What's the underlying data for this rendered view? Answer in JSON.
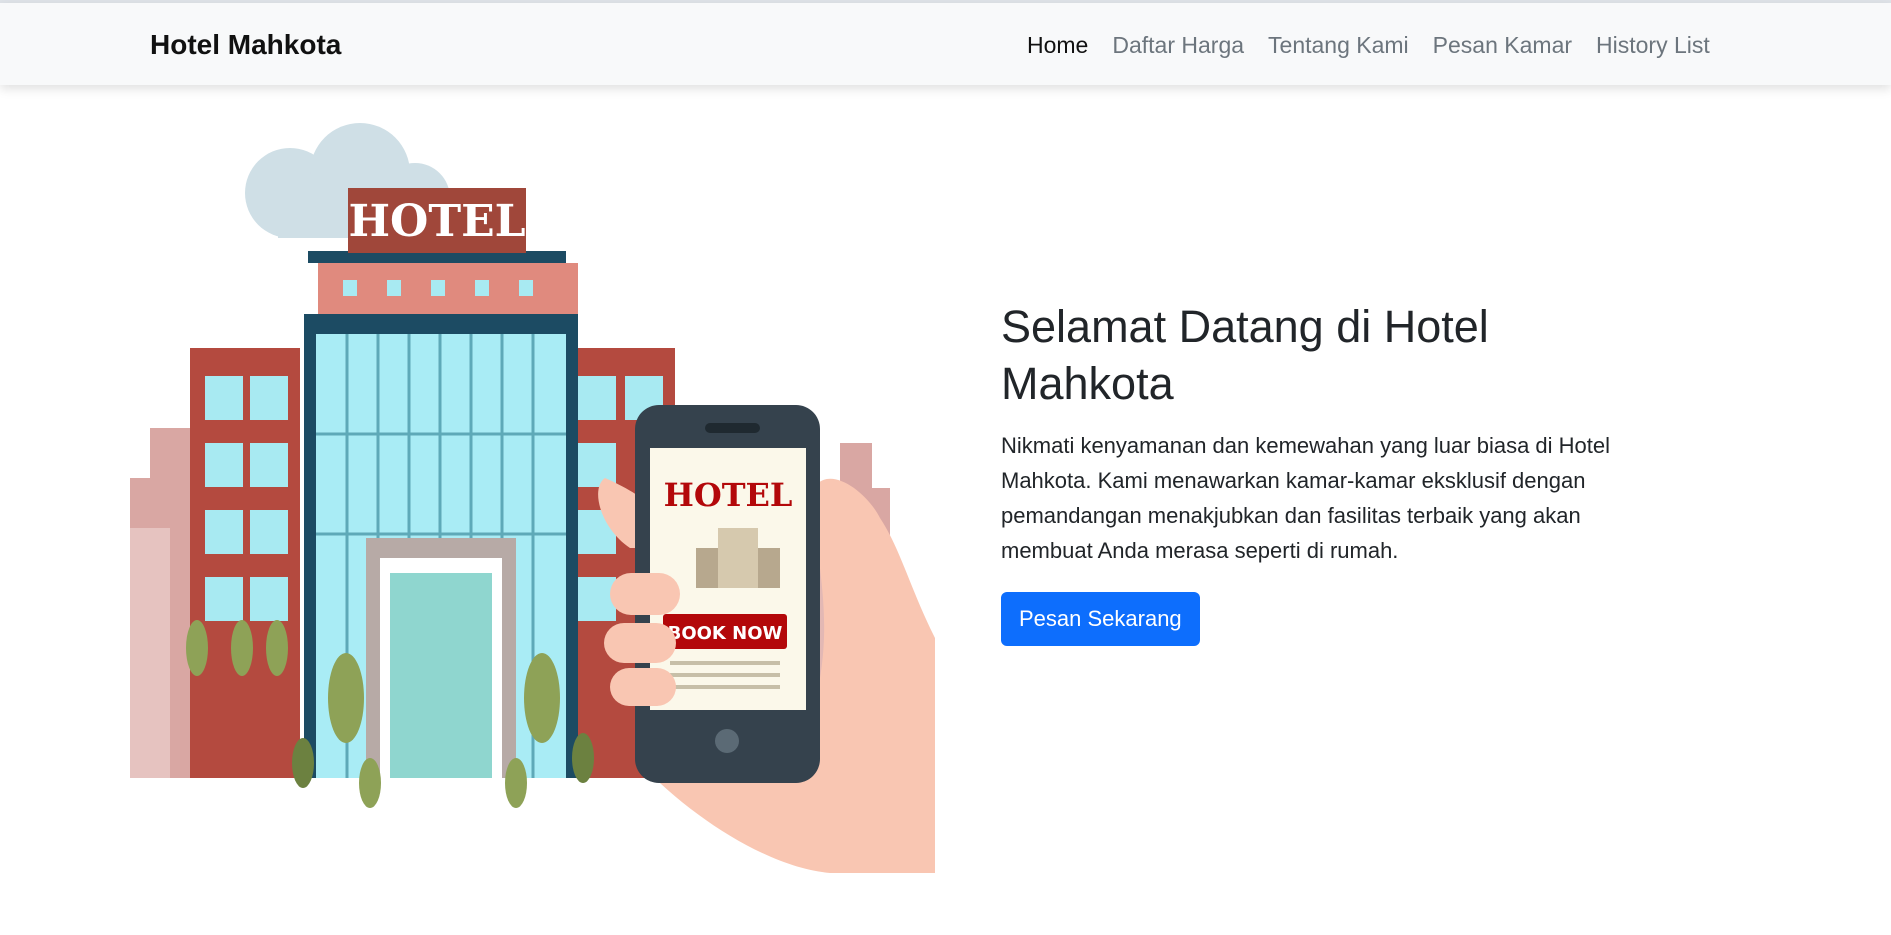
{
  "navbar": {
    "brand": "Hotel Mahkota",
    "items": [
      {
        "label": "Home",
        "active": true
      },
      {
        "label": "Daftar Harga",
        "active": false
      },
      {
        "label": "Tentang Kami",
        "active": false
      },
      {
        "label": "Pesan Kamar",
        "active": false
      },
      {
        "label": "History List",
        "active": false
      }
    ]
  },
  "hero": {
    "title": "Selamat Datang di Hotel Mahkota",
    "lead": "Nikmati kenyamanan dan kemewahan yang luar biasa di Hotel Mahkota. Kami menawarkan kamar-kamar eksklusif dengan pemandangan menakjubkan dan fasilitas terbaik yang akan membuat Anda merasa seperti di rumah.",
    "cta_label": "Pesan Sekarang",
    "illustration": {
      "sign_text": "HOTEL",
      "phone_sign_text": "HOTEL",
      "phone_button_text": "BOOK NOW"
    }
  },
  "colors": {
    "primary": "#0d6efd",
    "navbar_bg": "#f8f9fa",
    "hotel_sign": "#a0473a",
    "book_now": "#b3080a"
  }
}
